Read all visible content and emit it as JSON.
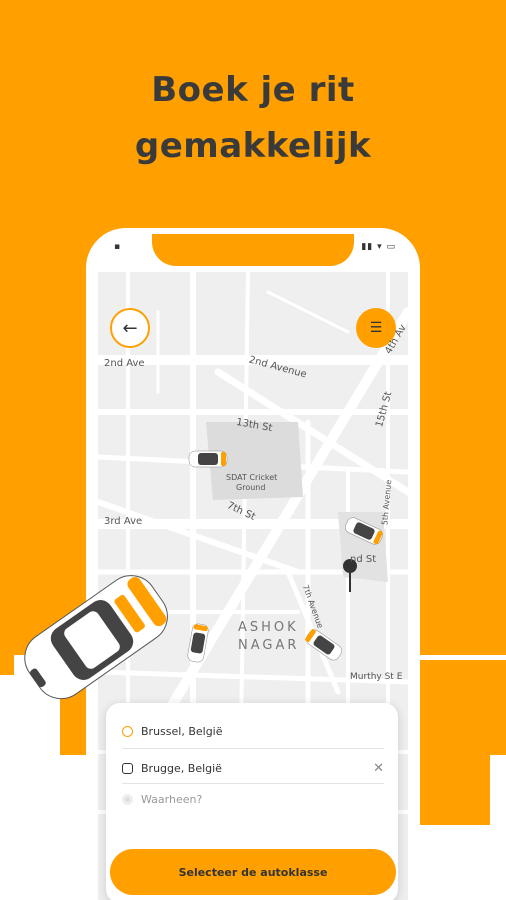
{
  "headline": {
    "line1": "Boek je rit",
    "line2": "gemakkelijk"
  },
  "colors": {
    "accent": "#FFA000",
    "dark": "#3a3a3a",
    "map_bg": "#efefef"
  },
  "map": {
    "labels": {
      "second_ave": "2nd Ave",
      "second_avenue": "2nd Avenue",
      "fourth_ave": "4th Av",
      "thirteenth_st": "13th St",
      "fifteenth_st": "15th St",
      "stadium": "SDAT Cricket",
      "stadium2": "Ground",
      "third_ave": "3rd Ave",
      "seventh_st": "7th St",
      "fifth_avenue": "5th Avenue",
      "second_st": "nd St",
      "seventh_avenue": "7th Avenue",
      "area1": "ASHOK",
      "area2": "NAGAR",
      "murthy": "Murthy St E"
    }
  },
  "icons": {
    "back": "arrow-left-icon",
    "menu": "menu-icon",
    "pin": "map-pin-icon",
    "close": "close-icon"
  },
  "trip": {
    "pickup": "Brussel, België",
    "dropoff": "Brugge, België",
    "where_placeholder": "Waarheen?",
    "close_symbol": "✕"
  },
  "cta_label": "Selecteer de autoklasse"
}
